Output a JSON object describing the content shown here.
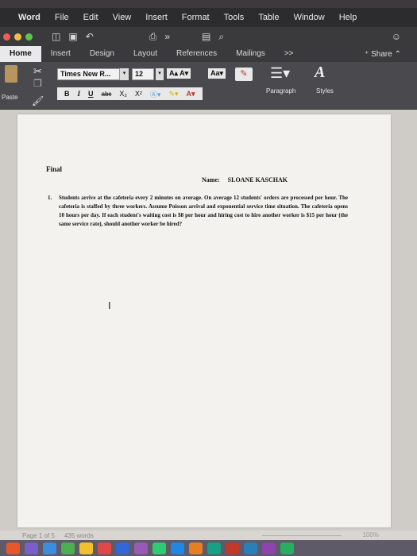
{
  "menubar": {
    "apple": "",
    "items": [
      "Word",
      "File",
      "Edit",
      "View",
      "Insert",
      "Format",
      "Tools",
      "Table",
      "Window",
      "Help"
    ]
  },
  "tabs": {
    "items": [
      "Home",
      "Insert",
      "Design",
      "Layout",
      "References",
      "Mailings",
      ">>"
    ],
    "active": "Home",
    "share": "Share"
  },
  "ribbon": {
    "paste_label": "Paste",
    "font_name": "Times New R...",
    "font_size": "12",
    "paragraph_label": "Paragraph",
    "styles_label": "Styles",
    "bold": "B",
    "italic": "I",
    "underline": "U",
    "strike": "abc",
    "subscript": "X₂",
    "superscript": "X²"
  },
  "document": {
    "title": "Final",
    "name_label": "Name:",
    "name_value": "SLOANE KASCHAK",
    "question_number": "1.",
    "question_text": "Students arrive at the cafeteria every 2 minutes on average. On average 12 students' orders are processed per hour. The cafeteria is staffed by three workers. Assume Poisson arrival and exponential service time situation. The cafeteria opens 10 hours per day. If each student's waiting cost is $8 per hour and hiring cost to hire another worker is $15 per hour (the same service rate), should another worker be hired?"
  },
  "status": {
    "page": "Page 1 of 5",
    "words": "435 words",
    "zoom": "100%"
  },
  "colors": {
    "traffic_red": "#ee5f57",
    "traffic_yellow": "#f3bd4f",
    "traffic_green": "#5cc84b",
    "ribbon": "#4a494d"
  }
}
